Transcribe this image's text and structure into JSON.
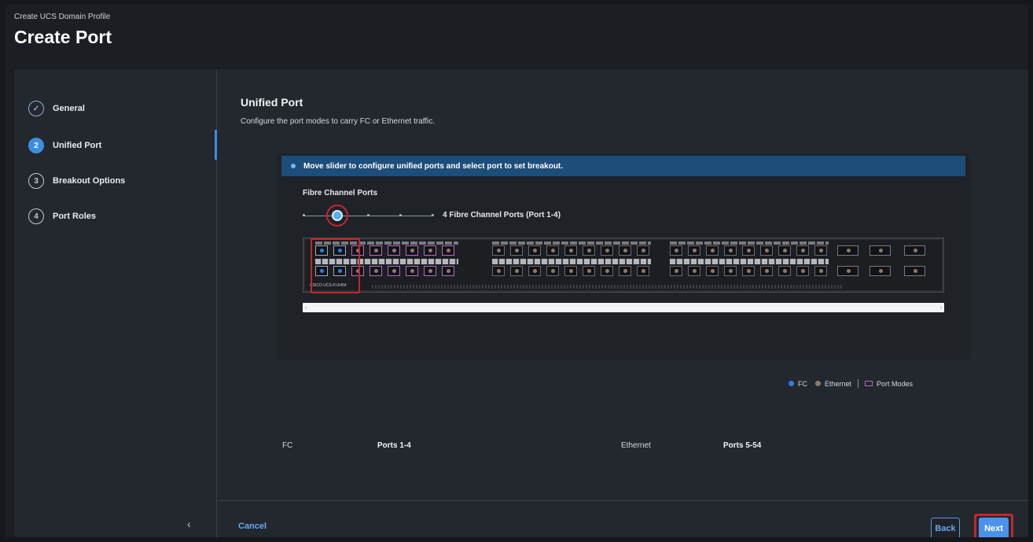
{
  "header": {
    "breadcrumb": "Create UCS Domain Profile",
    "title": "Create Port"
  },
  "steps": [
    {
      "number": "✓",
      "label": "General",
      "state": "completed"
    },
    {
      "number": "2",
      "label": "Unified Port",
      "state": "active"
    },
    {
      "number": "3",
      "label": "Breakout Options",
      "state": "pending"
    },
    {
      "number": "4",
      "label": "Port Roles",
      "state": "pending"
    }
  ],
  "sidebar": {
    "collapse_icon": "‹"
  },
  "main": {
    "title": "Unified Port",
    "subtitle": "Configure the port modes to carry FC or Ethernet traffic.",
    "banner": "Move slider to configure unified ports and select port to set breakout.",
    "slider_label": "Fibre Channel Ports",
    "slider_value_text": "4 Fibre Channel Ports (Port 1-4)",
    "slider_level_fraction": 0.25,
    "switch_model": "CISCO UCS-FI-6454",
    "legend": {
      "fc": "FC",
      "ethernet": "Ethernet",
      "port_modes": "Port Modes"
    },
    "summary": [
      {
        "key": "FC",
        "value": "Ports 1-4"
      },
      {
        "key": "Ethernet",
        "value": "Ports 5-54"
      }
    ]
  },
  "footer": {
    "cancel": "Cancel",
    "back": "Back",
    "next": "Next"
  },
  "colors": {
    "accent": "#3d8fdd",
    "fc": "#2f7fe0",
    "ethernet": "#8b7b6b",
    "port_mode": "#b26cc0",
    "highlight": "#c2272d",
    "banner": "#1d4d79"
  }
}
